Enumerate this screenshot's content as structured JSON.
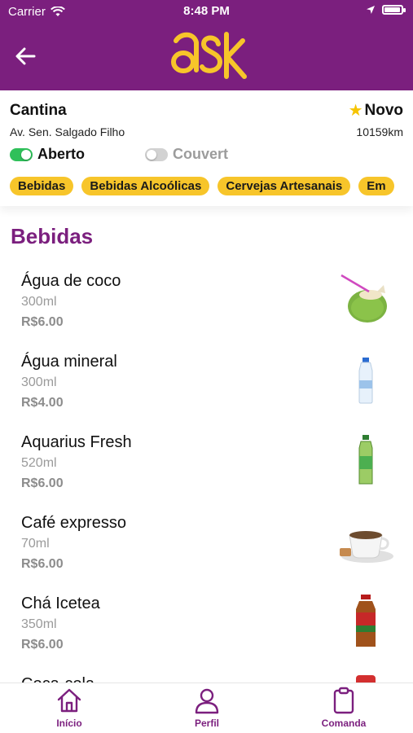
{
  "status_bar": {
    "carrier": "Carrier",
    "time": "8:48 PM"
  },
  "header": {
    "back_icon": "arrow-left-icon",
    "logo_text": "ask",
    "brand_color": "#7b1f7e",
    "accent_color": "#f7c52a"
  },
  "store": {
    "name": "Cantina",
    "address": "Av. Sen. Salgado Filho",
    "badge": "Novo",
    "distance": "10159km",
    "open_label": "Aberto",
    "open_state": true,
    "couvert_label": "Couvert",
    "couvert_state": false
  },
  "categories": [
    {
      "label": "Bebidas"
    },
    {
      "label": "Bebidas Alcoólicas"
    },
    {
      "label": "Cervejas Artesanais"
    },
    {
      "label": "Em"
    }
  ],
  "section": {
    "title": "Bebidas"
  },
  "products": [
    {
      "name": "Água de coco",
      "size": "300ml",
      "price": "R$6.00",
      "image": "coconut-image"
    },
    {
      "name": "Água mineral",
      "size": "300ml",
      "price": "R$4.00",
      "image": "water-bottle-image"
    },
    {
      "name": "Aquarius Fresh",
      "size": "520ml",
      "price": "R$6.00",
      "image": "green-bottle-image"
    },
    {
      "name": "Café expresso",
      "size": "70ml",
      "price": "R$6.00",
      "image": "coffee-cup-image"
    },
    {
      "name": "Chá Icetea",
      "size": "350ml",
      "price": "R$6.00",
      "image": "icetea-bottle-image"
    },
    {
      "name": "Coca-cola",
      "size": "",
      "price": "",
      "image": "soda-can-image"
    }
  ],
  "tabs": [
    {
      "label": "Início",
      "icon": "home-icon"
    },
    {
      "label": "Perfil",
      "icon": "profile-icon"
    },
    {
      "label": "Comanda",
      "icon": "clipboard-icon"
    }
  ]
}
